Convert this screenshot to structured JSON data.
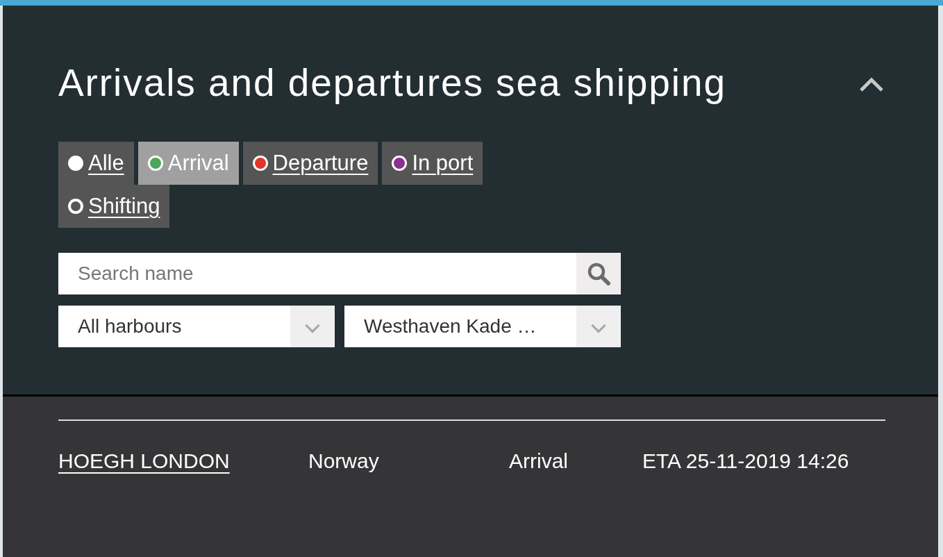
{
  "panel": {
    "title": "Arrivals and departures sea shipping",
    "expanded": true
  },
  "filters": [
    {
      "label": "Alle",
      "kind": "dot",
      "color": "#ffffff",
      "selected": false
    },
    {
      "label": "Arrival",
      "kind": "dot",
      "color": "#4ca65a",
      "selected": true
    },
    {
      "label": "Departure",
      "kind": "dot",
      "color": "#e0352b",
      "selected": false
    },
    {
      "label": "In port",
      "kind": "dot",
      "color": "#8c2f94",
      "selected": false
    },
    {
      "label": "Shifting",
      "kind": "ring",
      "selected": false
    }
  ],
  "search": {
    "placeholder": "Search name"
  },
  "dropdowns": [
    {
      "value": "All harbours"
    },
    {
      "value": "Westhaven Kade …"
    }
  ],
  "results": [
    {
      "name": "HOEGH LONDON",
      "country": "Norway",
      "status": "Arrival",
      "time": "ETA 25-11-2019 14:26"
    }
  ]
}
